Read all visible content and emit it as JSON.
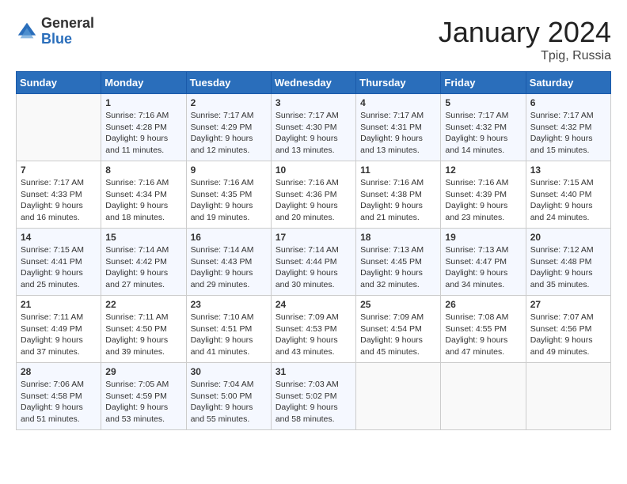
{
  "header": {
    "logo_general": "General",
    "logo_blue": "Blue",
    "title": "January 2024",
    "location": "Tpig, Russia"
  },
  "days_of_week": [
    "Sunday",
    "Monday",
    "Tuesday",
    "Wednesday",
    "Thursday",
    "Friday",
    "Saturday"
  ],
  "weeks": [
    [
      {
        "day": "",
        "sunrise": "",
        "sunset": "",
        "daylight": ""
      },
      {
        "day": "1",
        "sunrise": "Sunrise: 7:16 AM",
        "sunset": "Sunset: 4:28 PM",
        "daylight": "Daylight: 9 hours and 11 minutes."
      },
      {
        "day": "2",
        "sunrise": "Sunrise: 7:17 AM",
        "sunset": "Sunset: 4:29 PM",
        "daylight": "Daylight: 9 hours and 12 minutes."
      },
      {
        "day": "3",
        "sunrise": "Sunrise: 7:17 AM",
        "sunset": "Sunset: 4:30 PM",
        "daylight": "Daylight: 9 hours and 13 minutes."
      },
      {
        "day": "4",
        "sunrise": "Sunrise: 7:17 AM",
        "sunset": "Sunset: 4:31 PM",
        "daylight": "Daylight: 9 hours and 13 minutes."
      },
      {
        "day": "5",
        "sunrise": "Sunrise: 7:17 AM",
        "sunset": "Sunset: 4:32 PM",
        "daylight": "Daylight: 9 hours and 14 minutes."
      },
      {
        "day": "6",
        "sunrise": "Sunrise: 7:17 AM",
        "sunset": "Sunset: 4:32 PM",
        "daylight": "Daylight: 9 hours and 15 minutes."
      }
    ],
    [
      {
        "day": "7",
        "sunrise": "Sunrise: 7:17 AM",
        "sunset": "Sunset: 4:33 PM",
        "daylight": "Daylight: 9 hours and 16 minutes."
      },
      {
        "day": "8",
        "sunrise": "Sunrise: 7:16 AM",
        "sunset": "Sunset: 4:34 PM",
        "daylight": "Daylight: 9 hours and 18 minutes."
      },
      {
        "day": "9",
        "sunrise": "Sunrise: 7:16 AM",
        "sunset": "Sunset: 4:35 PM",
        "daylight": "Daylight: 9 hours and 19 minutes."
      },
      {
        "day": "10",
        "sunrise": "Sunrise: 7:16 AM",
        "sunset": "Sunset: 4:36 PM",
        "daylight": "Daylight: 9 hours and 20 minutes."
      },
      {
        "day": "11",
        "sunrise": "Sunrise: 7:16 AM",
        "sunset": "Sunset: 4:38 PM",
        "daylight": "Daylight: 9 hours and 21 minutes."
      },
      {
        "day": "12",
        "sunrise": "Sunrise: 7:16 AM",
        "sunset": "Sunset: 4:39 PM",
        "daylight": "Daylight: 9 hours and 23 minutes."
      },
      {
        "day": "13",
        "sunrise": "Sunrise: 7:15 AM",
        "sunset": "Sunset: 4:40 PM",
        "daylight": "Daylight: 9 hours and 24 minutes."
      }
    ],
    [
      {
        "day": "14",
        "sunrise": "Sunrise: 7:15 AM",
        "sunset": "Sunset: 4:41 PM",
        "daylight": "Daylight: 9 hours and 25 minutes."
      },
      {
        "day": "15",
        "sunrise": "Sunrise: 7:14 AM",
        "sunset": "Sunset: 4:42 PM",
        "daylight": "Daylight: 9 hours and 27 minutes."
      },
      {
        "day": "16",
        "sunrise": "Sunrise: 7:14 AM",
        "sunset": "Sunset: 4:43 PM",
        "daylight": "Daylight: 9 hours and 29 minutes."
      },
      {
        "day": "17",
        "sunrise": "Sunrise: 7:14 AM",
        "sunset": "Sunset: 4:44 PM",
        "daylight": "Daylight: 9 hours and 30 minutes."
      },
      {
        "day": "18",
        "sunrise": "Sunrise: 7:13 AM",
        "sunset": "Sunset: 4:45 PM",
        "daylight": "Daylight: 9 hours and 32 minutes."
      },
      {
        "day": "19",
        "sunrise": "Sunrise: 7:13 AM",
        "sunset": "Sunset: 4:47 PM",
        "daylight": "Daylight: 9 hours and 34 minutes."
      },
      {
        "day": "20",
        "sunrise": "Sunrise: 7:12 AM",
        "sunset": "Sunset: 4:48 PM",
        "daylight": "Daylight: 9 hours and 35 minutes."
      }
    ],
    [
      {
        "day": "21",
        "sunrise": "Sunrise: 7:11 AM",
        "sunset": "Sunset: 4:49 PM",
        "daylight": "Daylight: 9 hours and 37 minutes."
      },
      {
        "day": "22",
        "sunrise": "Sunrise: 7:11 AM",
        "sunset": "Sunset: 4:50 PM",
        "daylight": "Daylight: 9 hours and 39 minutes."
      },
      {
        "day": "23",
        "sunrise": "Sunrise: 7:10 AM",
        "sunset": "Sunset: 4:51 PM",
        "daylight": "Daylight: 9 hours and 41 minutes."
      },
      {
        "day": "24",
        "sunrise": "Sunrise: 7:09 AM",
        "sunset": "Sunset: 4:53 PM",
        "daylight": "Daylight: 9 hours and 43 minutes."
      },
      {
        "day": "25",
        "sunrise": "Sunrise: 7:09 AM",
        "sunset": "Sunset: 4:54 PM",
        "daylight": "Daylight: 9 hours and 45 minutes."
      },
      {
        "day": "26",
        "sunrise": "Sunrise: 7:08 AM",
        "sunset": "Sunset: 4:55 PM",
        "daylight": "Daylight: 9 hours and 47 minutes."
      },
      {
        "day": "27",
        "sunrise": "Sunrise: 7:07 AM",
        "sunset": "Sunset: 4:56 PM",
        "daylight": "Daylight: 9 hours and 49 minutes."
      }
    ],
    [
      {
        "day": "28",
        "sunrise": "Sunrise: 7:06 AM",
        "sunset": "Sunset: 4:58 PM",
        "daylight": "Daylight: 9 hours and 51 minutes."
      },
      {
        "day": "29",
        "sunrise": "Sunrise: 7:05 AM",
        "sunset": "Sunset: 4:59 PM",
        "daylight": "Daylight: 9 hours and 53 minutes."
      },
      {
        "day": "30",
        "sunrise": "Sunrise: 7:04 AM",
        "sunset": "Sunset: 5:00 PM",
        "daylight": "Daylight: 9 hours and 55 minutes."
      },
      {
        "day": "31",
        "sunrise": "Sunrise: 7:03 AM",
        "sunset": "Sunset: 5:02 PM",
        "daylight": "Daylight: 9 hours and 58 minutes."
      },
      {
        "day": "",
        "sunrise": "",
        "sunset": "",
        "daylight": ""
      },
      {
        "day": "",
        "sunrise": "",
        "sunset": "",
        "daylight": ""
      },
      {
        "day": "",
        "sunrise": "",
        "sunset": "",
        "daylight": ""
      }
    ]
  ]
}
